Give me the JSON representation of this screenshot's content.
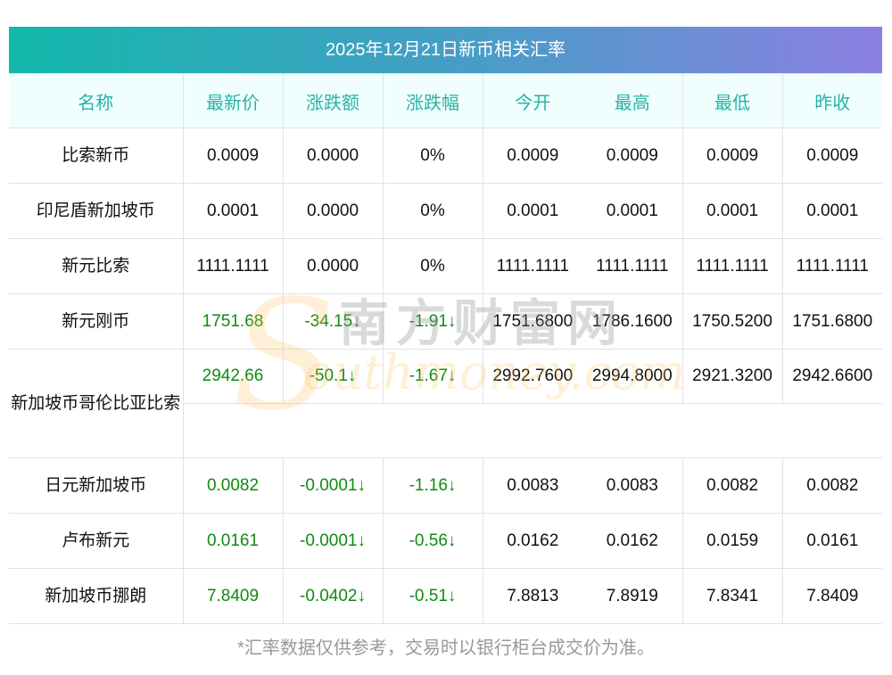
{
  "title": "2025年12月21日新币相关汇率",
  "headers": [
    "名称",
    "最新价",
    "涨跌额",
    "涨跌幅",
    "今开",
    "最高",
    "最低",
    "昨收"
  ],
  "rows": [
    {
      "name": "比索新币",
      "vals": [
        "0.0009",
        "0.0000",
        "0%",
        "0.0009",
        "0.0009",
        "0.0009",
        "0.0009"
      ],
      "green": false
    },
    {
      "name": "印尼盾新加坡币",
      "vals": [
        "0.0001",
        "0.0000",
        "0%",
        "0.0001",
        "0.0001",
        "0.0001",
        "0.0001"
      ],
      "green": false
    },
    {
      "name": "新元比索",
      "vals": [
        "1111.1111",
        "0.0000",
        "0%",
        "1111.1111",
        "1111.1111",
        "1111.1111",
        "1111.1111"
      ],
      "green": false
    },
    {
      "name": "新元刚币",
      "vals": [
        "1751.68",
        "-34.15↓",
        "-1.91↓",
        "1751.6800",
        "1786.1600",
        "1750.5200",
        "1751.6800"
      ],
      "green": true
    },
    {
      "name": "新加坡币哥伦比亚比索",
      "vals": [
        "2942.66",
        "-50.1↓",
        "-1.67↓",
        "2992.7600",
        "2994.8000",
        "2921.3200",
        "2942.6600"
      ],
      "green": true
    },
    {
      "name": "日元新加坡币",
      "vals": [
        "0.0082",
        "-0.0001↓",
        "-1.16↓",
        "0.0083",
        "0.0083",
        "0.0082",
        "0.0082"
      ],
      "green": true
    },
    {
      "name": "卢布新元",
      "vals": [
        "0.0161",
        "-0.0001↓",
        "-0.56↓",
        "0.0162",
        "0.0162",
        "0.0159",
        "0.0161"
      ],
      "green": true
    },
    {
      "name": "新加坡币挪朗",
      "vals": [
        "7.8409",
        "-0.0402↓",
        "-0.51↓",
        "7.8813",
        "7.8919",
        "7.8341",
        "7.8409"
      ],
      "green": true
    }
  ],
  "watermark": {
    "cn": "南方财富网",
    "en": "outhmoney.com",
    "s": "S"
  },
  "note": "*汇率数据仅供参考，交易时以银行柜台成交价为准。"
}
